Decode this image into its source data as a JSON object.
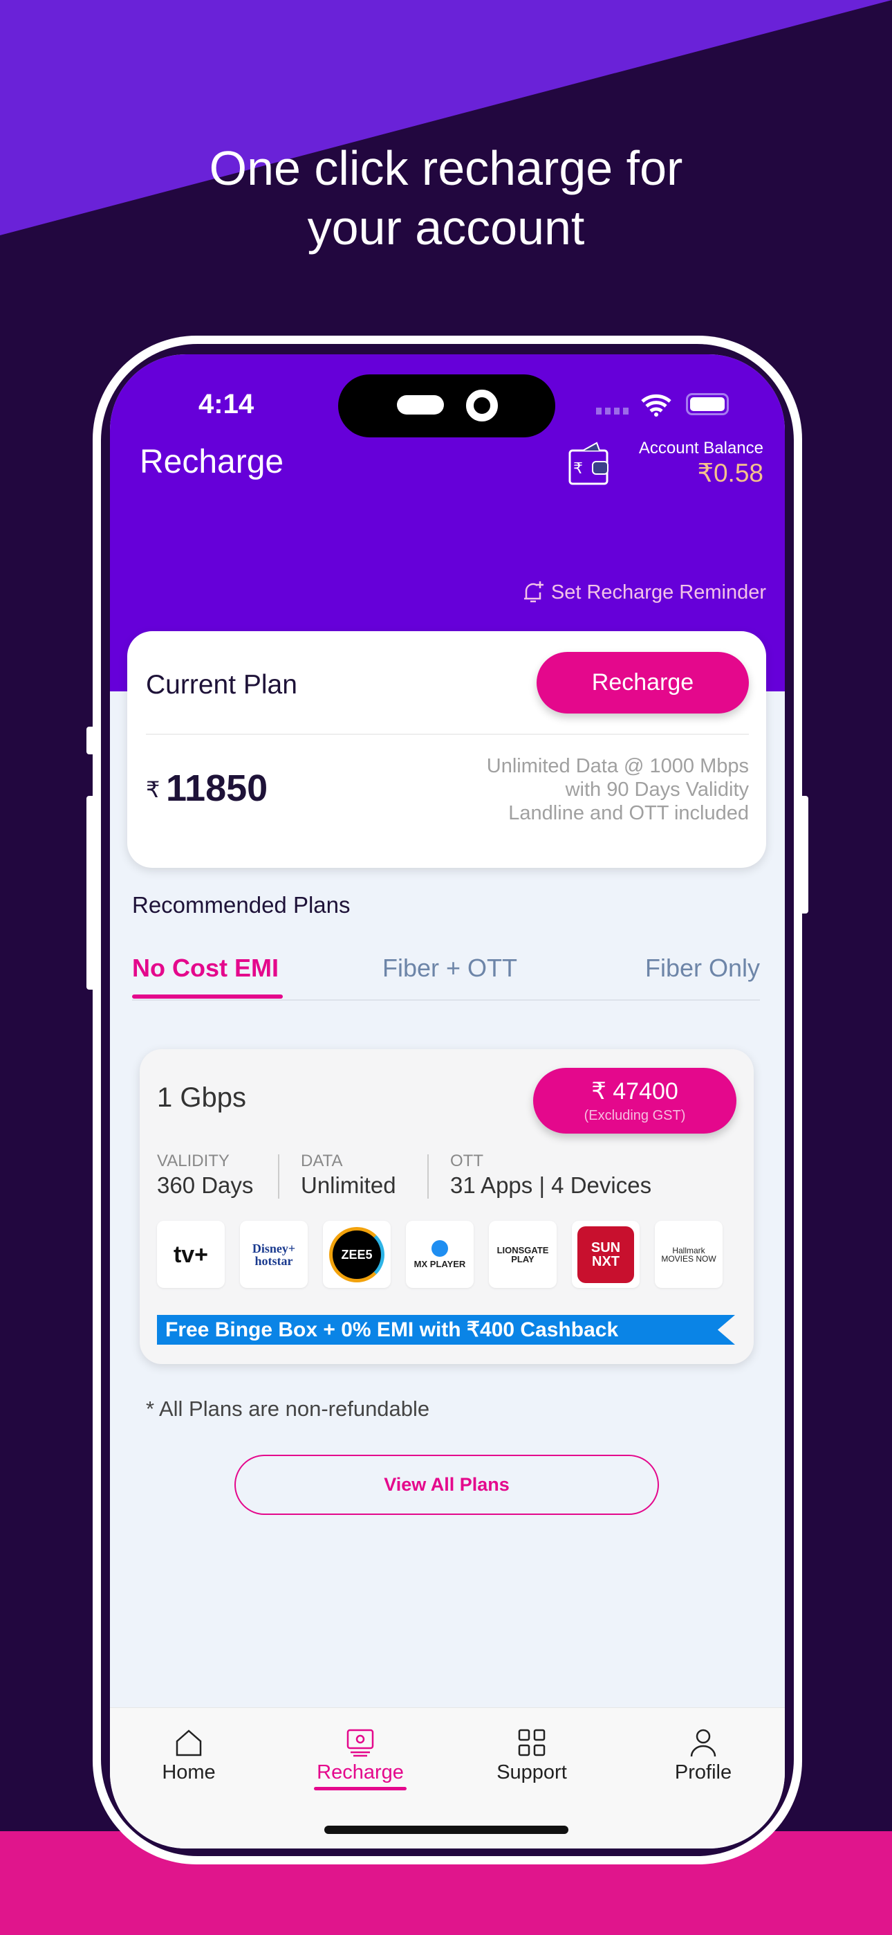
{
  "promo": {
    "headline_line1": "One click recharge for",
    "headline_line2": "your account"
  },
  "status_bar": {
    "time": "4:14"
  },
  "header": {
    "title": "Recharge",
    "balance_label": "Account Balance",
    "balance_value": "₹0.58",
    "reminder_label": "Set Recharge Reminder"
  },
  "current_plan": {
    "title": "Current Plan",
    "recharge_button": "Recharge",
    "currency": "₹",
    "amount": "11850",
    "description": [
      "Unlimited Data @ 1000 Mbps",
      "with 90 Days Validity",
      "Landline and OTT included"
    ]
  },
  "recommended": {
    "title": "Recommended Plans",
    "tabs": [
      {
        "label": "No Cost EMI",
        "active": true
      },
      {
        "label": "Fiber + OTT",
        "active": false
      },
      {
        "label": "Fiber Only",
        "active": false
      }
    ]
  },
  "plan": {
    "speed": "1 Gbps",
    "price": "₹ 47400",
    "price_note": "(Excluding GST)",
    "specs": [
      {
        "label": "VALIDITY",
        "value": "360 Days"
      },
      {
        "label": "DATA",
        "value": "Unlimited"
      },
      {
        "label": "OTT",
        "value": "31 Apps | 4 Devices"
      }
    ],
    "ott_apps": [
      "tv+",
      "Disney+ hotstar",
      "ZEE5",
      "MX PLAYER",
      "LIONSGATE PLAY",
      "SUN NXT",
      "Hallmark MOVIES NOW"
    ],
    "offer": "Free Binge Box + 0% EMI with ₹400 Cashback"
  },
  "disclaimer": "* All Plans are non-refundable",
  "view_all_button": "View All Plans",
  "bottom_nav": [
    {
      "label": "Home",
      "icon": "home-icon"
    },
    {
      "label": "Recharge",
      "icon": "recharge-icon",
      "active": true
    },
    {
      "label": "Support",
      "icon": "grid-icon"
    },
    {
      "label": "Profile",
      "icon": "profile-icon"
    }
  ],
  "colors": {
    "brand_purple": "#6600d9",
    "accent_pink": "#e4088c",
    "offer_blue": "#0a84e6",
    "background_dark": "#22073f"
  }
}
